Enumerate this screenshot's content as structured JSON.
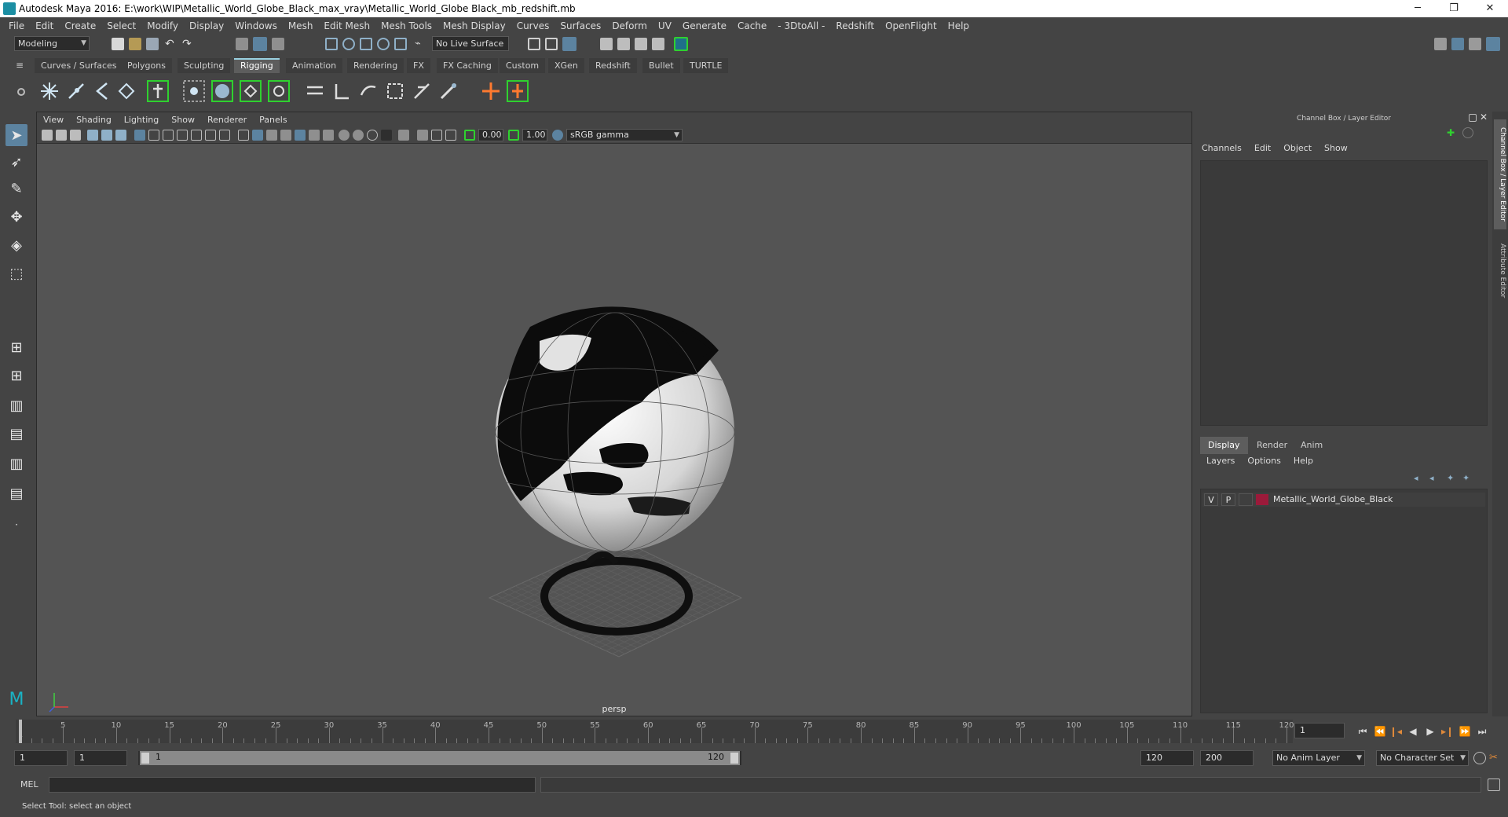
{
  "window": {
    "title": "Autodesk Maya 2016: E:\\work\\WIP\\Metallic_World_Globe_Black_max_vray\\Metallic_World_Globe Black_mb_redshift.mb",
    "minimize": "─",
    "restore": "❐",
    "close": "✕"
  },
  "menubar": [
    "File",
    "Edit",
    "Create",
    "Select",
    "Modify",
    "Display",
    "Windows",
    "Mesh",
    "Edit Mesh",
    "Mesh Tools",
    "Mesh Display",
    "Curves",
    "Surfaces",
    "Deform",
    "UV",
    "Generate",
    "Cache",
    "- 3DtoAll -",
    "Redshift",
    "OpenFlight",
    "Help"
  ],
  "statusline": {
    "mode": "Modeling",
    "live_surface": "No Live Surface"
  },
  "shelf": {
    "tabs": [
      "Curves / Surfaces",
      "Polygons",
      "Sculpting",
      "Rigging",
      "Animation",
      "Rendering",
      "FX",
      "FX Caching",
      "Custom",
      "XGen",
      "Redshift",
      "Bullet",
      "TURTLE"
    ],
    "active_tab": "Rigging"
  },
  "viewport": {
    "menu": [
      "View",
      "Shading",
      "Lighting",
      "Show",
      "Renderer",
      "Panels"
    ],
    "exposure": "0.00",
    "gamma": "1.00",
    "color_space": "sRGB gamma",
    "camera_label": "persp"
  },
  "right_panel": {
    "title": "Channel Box / Layer Editor",
    "channel_menu": [
      "Channels",
      "Edit",
      "Object",
      "Show"
    ],
    "layer_tabs": [
      "Display",
      "Render",
      "Anim"
    ],
    "active_layer_tab": "Display",
    "layer_menu": [
      "Layers",
      "Options",
      "Help"
    ],
    "layers": [
      {
        "v": "V",
        "p": "P",
        "color": "#9b1a3a",
        "name": "Metallic_World_Globe_Black"
      }
    ],
    "side_tabs": [
      "Channel Box / Layer Editor",
      "Attribute Editor"
    ]
  },
  "timeslider": {
    "labels": [
      "1",
      "5",
      "10",
      "15",
      "20",
      "25",
      "30",
      "35",
      "40",
      "45",
      "50",
      "55",
      "60",
      "65",
      "70",
      "75",
      "80",
      "85",
      "90",
      "95",
      "100",
      "105",
      "110",
      "115",
      "120"
    ],
    "current_frame": "1"
  },
  "rangeslider": {
    "start_field": "1",
    "playback_start": "1",
    "range_start_label": "1",
    "range_end_label": "120",
    "playback_end": "120",
    "end_field": "200",
    "anim_layer": "No Anim Layer",
    "character_set": "No Character Set"
  },
  "commandline": {
    "label": "MEL"
  },
  "helpline": {
    "text": "Select Tool: select an object"
  },
  "colors": {
    "accent_blue": "#5c83a0",
    "highlight_green": "#2fd12f",
    "layer_red": "#9b1a3a"
  }
}
